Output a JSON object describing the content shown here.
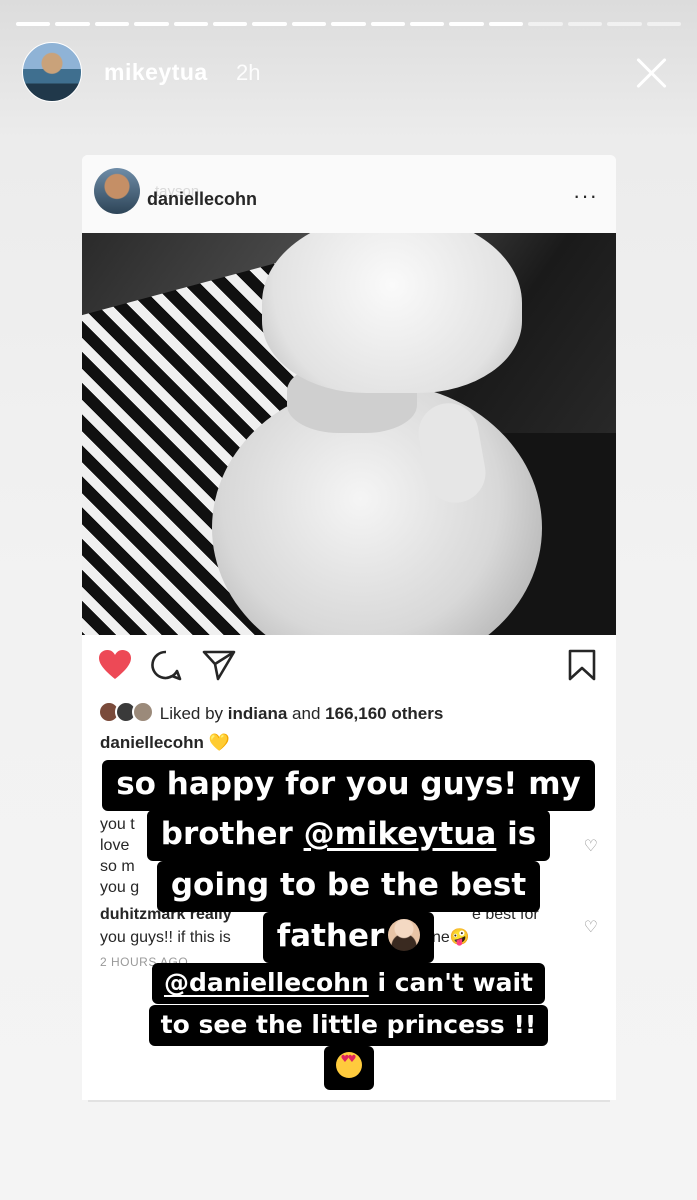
{
  "story": {
    "username": "mikeytua",
    "time": "2h",
    "progress_segments": 17,
    "progress_viewed": 13
  },
  "post": {
    "username_overlay": "tayson",
    "username": "daniellecohn",
    "more_icon": "···",
    "liked_prefix": "Liked by",
    "liked_name": "indiana",
    "liked_mid": "and",
    "liked_count": "166,160 others",
    "caption_user": "daniellecohn",
    "caption_emoji": "💛",
    "comments": [
      {
        "lines": [
          "you t",
          "love",
          "so m",
          "you g"
        ]
      },
      {
        "user": "duhitzmark",
        "line1_visible": "duhitzmark really",
        "line1_right": "e best for",
        "line2": "you guys!! if this is",
        "line2_right": "ne🤪"
      }
    ],
    "timestamp": "2 HOURS AGO"
  },
  "overlay": {
    "line1": "so happy for you guys! my",
    "line2_prefix": "brother ",
    "line2_mention": "@mikeytua",
    "line2_suffix": " is",
    "line3": "going to be the best",
    "line4": "father",
    "line5_mention": "@daniellecohn",
    "line5_suffix": " i can't wait",
    "line6": "to see the little princess !!",
    "emoji_face": "man-beard-emoji",
    "emoji_love": "heart-eyes-emoji"
  },
  "colors": {
    "heart": "#ed4956",
    "caption_emoji": "#f5c542",
    "highlight_bg": "#000000"
  }
}
